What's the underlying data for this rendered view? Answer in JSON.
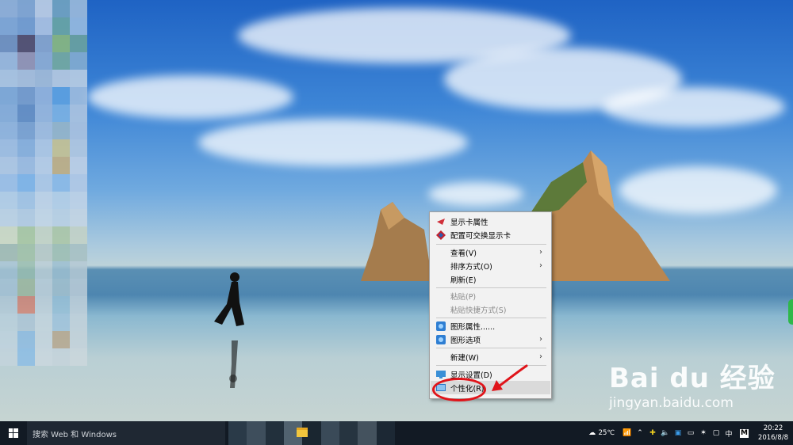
{
  "context_menu": {
    "items": [
      {
        "label": "显示卡属性",
        "icon": "graphics-card-icon",
        "submenu": false,
        "disabled": false
      },
      {
        "label": "配置可交换显示卡",
        "icon": "switchable-graphics-icon",
        "submenu": false,
        "disabled": false
      },
      {
        "label": "查看(V)",
        "submenu": true,
        "disabled": false
      },
      {
        "label": "排序方式(O)",
        "submenu": true,
        "disabled": false
      },
      {
        "label": "刷新(E)",
        "submenu": false,
        "disabled": false
      },
      {
        "label": "粘贴(P)",
        "submenu": false,
        "disabled": true
      },
      {
        "label": "粘贴快捷方式(S)",
        "submenu": false,
        "disabled": true
      },
      {
        "label": "图形属性......",
        "icon": "intel-graphics-icon",
        "submenu": false,
        "disabled": false
      },
      {
        "label": "图形选项",
        "icon": "intel-graphics-icon",
        "submenu": true,
        "disabled": false
      },
      {
        "label": "新建(W)",
        "submenu": true,
        "disabled": false
      },
      {
        "label": "显示设置(D)",
        "icon": "display-settings-icon",
        "submenu": false,
        "disabled": false
      },
      {
        "label": "个性化(R)",
        "icon": "personalize-icon",
        "submenu": false,
        "disabled": false,
        "highlighted": true
      }
    ]
  },
  "watermark": {
    "brand": "Bai du 经验",
    "url": "jingyan.baidu.com"
  },
  "taskbar": {
    "search_placeholder": "搜索 Web 和 Windows",
    "weather": "25℃",
    "ime": "中",
    "ime_mode": "M",
    "time": "20:22",
    "date": "2016/8/8"
  },
  "colors": {
    "annotation": "#e0141a",
    "taskbar": "#121a24",
    "menu_bg": "#f2f2f2"
  }
}
